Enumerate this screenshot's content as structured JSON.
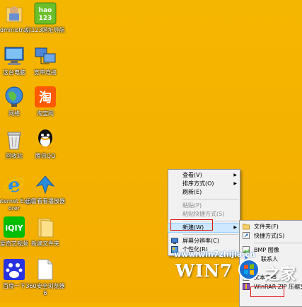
{
  "desktop_icons": [
    {
      "label": "Administra...",
      "icon": "user-folder-icon"
    },
    {
      "label": "好123网址导航",
      "icon": "hao123-icon"
    },
    {
      "label": "这台电脑",
      "icon": "computer-icon"
    },
    {
      "label": "宽带连接",
      "icon": "network-icon"
    },
    {
      "label": "网络",
      "icon": "globe-network-icon"
    },
    {
      "label": "淘宝网",
      "icon": "taobao-icon"
    },
    {
      "label": "回收站",
      "icon": "recycle-bin-icon"
    },
    {
      "label": "腾讯QQ",
      "icon": "qq-icon"
    },
    {
      "label": "Internet Explorer",
      "icon": "ie-icon"
    },
    {
      "label": "迅雷看看播放器",
      "icon": "xunlei-icon"
    },
    {
      "label": "爱奇艺视频",
      "icon": "iqiyi-icon"
    },
    {
      "label": "新建文件夹",
      "icon": "folder-icon"
    },
    {
      "label": "百度一下",
      "icon": "baidu-icon"
    },
    {
      "label": "360安全浏览器6",
      "icon": "file-icon"
    }
  ],
  "context_menu": {
    "items": [
      {
        "label": "查看(V)",
        "submenu": true,
        "disabled": false
      },
      {
        "label": "排序方式(O)",
        "submenu": true,
        "disabled": false
      },
      {
        "label": "刷新(E)",
        "submenu": false,
        "disabled": false
      },
      {
        "label": "粘贴(P)",
        "submenu": false,
        "disabled": true
      },
      {
        "label": "粘贴快捷方式(S)",
        "submenu": false,
        "disabled": true
      },
      {
        "label": "新建(W)",
        "submenu": true,
        "disabled": false
      },
      {
        "label": "屏幕分辨率(C)",
        "submenu": false,
        "disabled": false
      },
      {
        "label": "个性化(R)",
        "submenu": false,
        "disabled": false
      }
    ]
  },
  "submenu": {
    "items": [
      {
        "label": "文件夹(F)"
      },
      {
        "label": "快捷方式(S)"
      },
      {
        "label": "BMP 图像"
      },
      {
        "label": "联系人"
      },
      {
        "label": "文本文档"
      },
      {
        "label": "WinRAR ZIP 压缩文件"
      }
    ]
  },
  "watermark": {
    "url": "www.win7zhijia.cn",
    "logo": "WIN7",
    "suffix": "之家"
  },
  "colors": {
    "desktop": "#f4b400",
    "highlight": "#cde8ff",
    "redbox": "#e01010"
  }
}
